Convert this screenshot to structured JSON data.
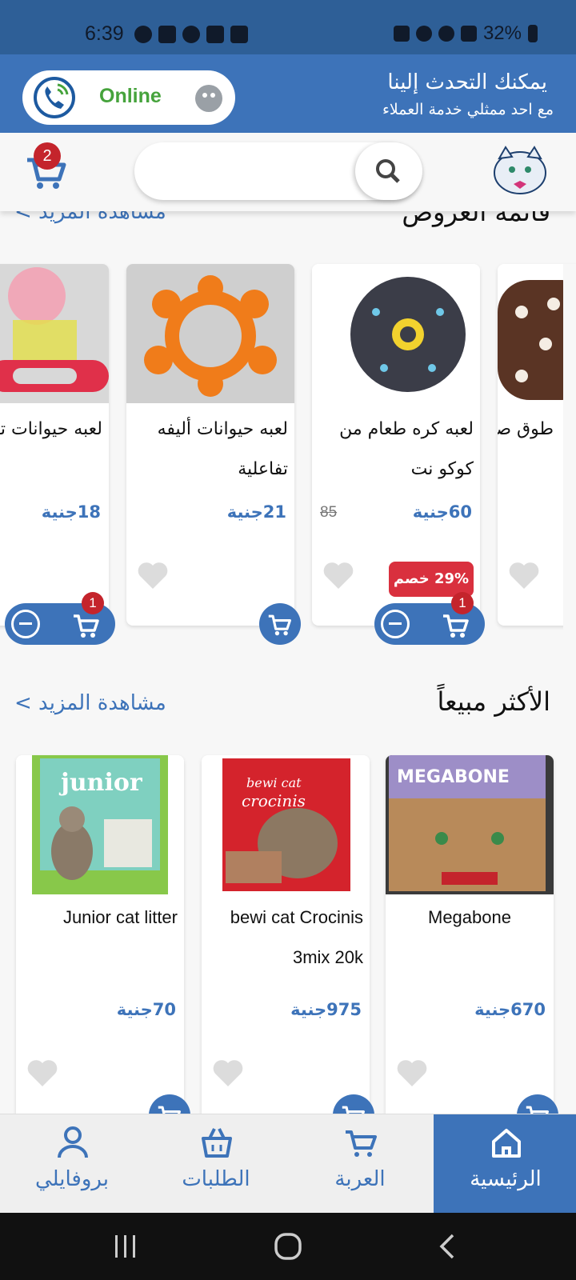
{
  "status_bar": {
    "time": "6:39",
    "battery": "32%"
  },
  "contact": {
    "status": "Online",
    "title": "يمكنك التحدث إلينا",
    "subtitle": "مع احد ممثلي خدمة العملاء"
  },
  "header": {
    "cart_count": "2"
  },
  "offers": {
    "title": "قائمة العروض",
    "see_more": "مشاهدة المزيد >",
    "items": [
      {
        "name": "لعبه حيوانات تفاعليه",
        "price": "18جنية",
        "qty": "1"
      },
      {
        "name": "لعبه حيوانات أليفه تفاعلية",
        "price": "21جنية"
      },
      {
        "name": "لعبه كره طعام من كوكو نت",
        "price": "60جنية",
        "old_price": "85",
        "discount": "29% خصم",
        "qty": "1"
      },
      {
        "name": "طوق صغيره"
      }
    ]
  },
  "bestsellers": {
    "title": "الأكثر مبيعاً",
    "see_more": "مشاهدة المزيد >",
    "items": [
      {
        "name": "Junior cat litter",
        "price": "70جنية"
      },
      {
        "name": "bewi cat Crocinis 3mix 20k",
        "price": "975جنية"
      },
      {
        "name": "Megabone",
        "price": "670جنية"
      }
    ]
  },
  "nav": {
    "profile": "بروفايلي",
    "orders": "الطلبات",
    "cart": "العربة",
    "home": "الرئيسية"
  },
  "colors": {
    "primary": "#3d73b9",
    "status_bar": "#2e5f97",
    "badge": "#c4242c",
    "discount": "#d9303e",
    "online": "#46a33c"
  }
}
